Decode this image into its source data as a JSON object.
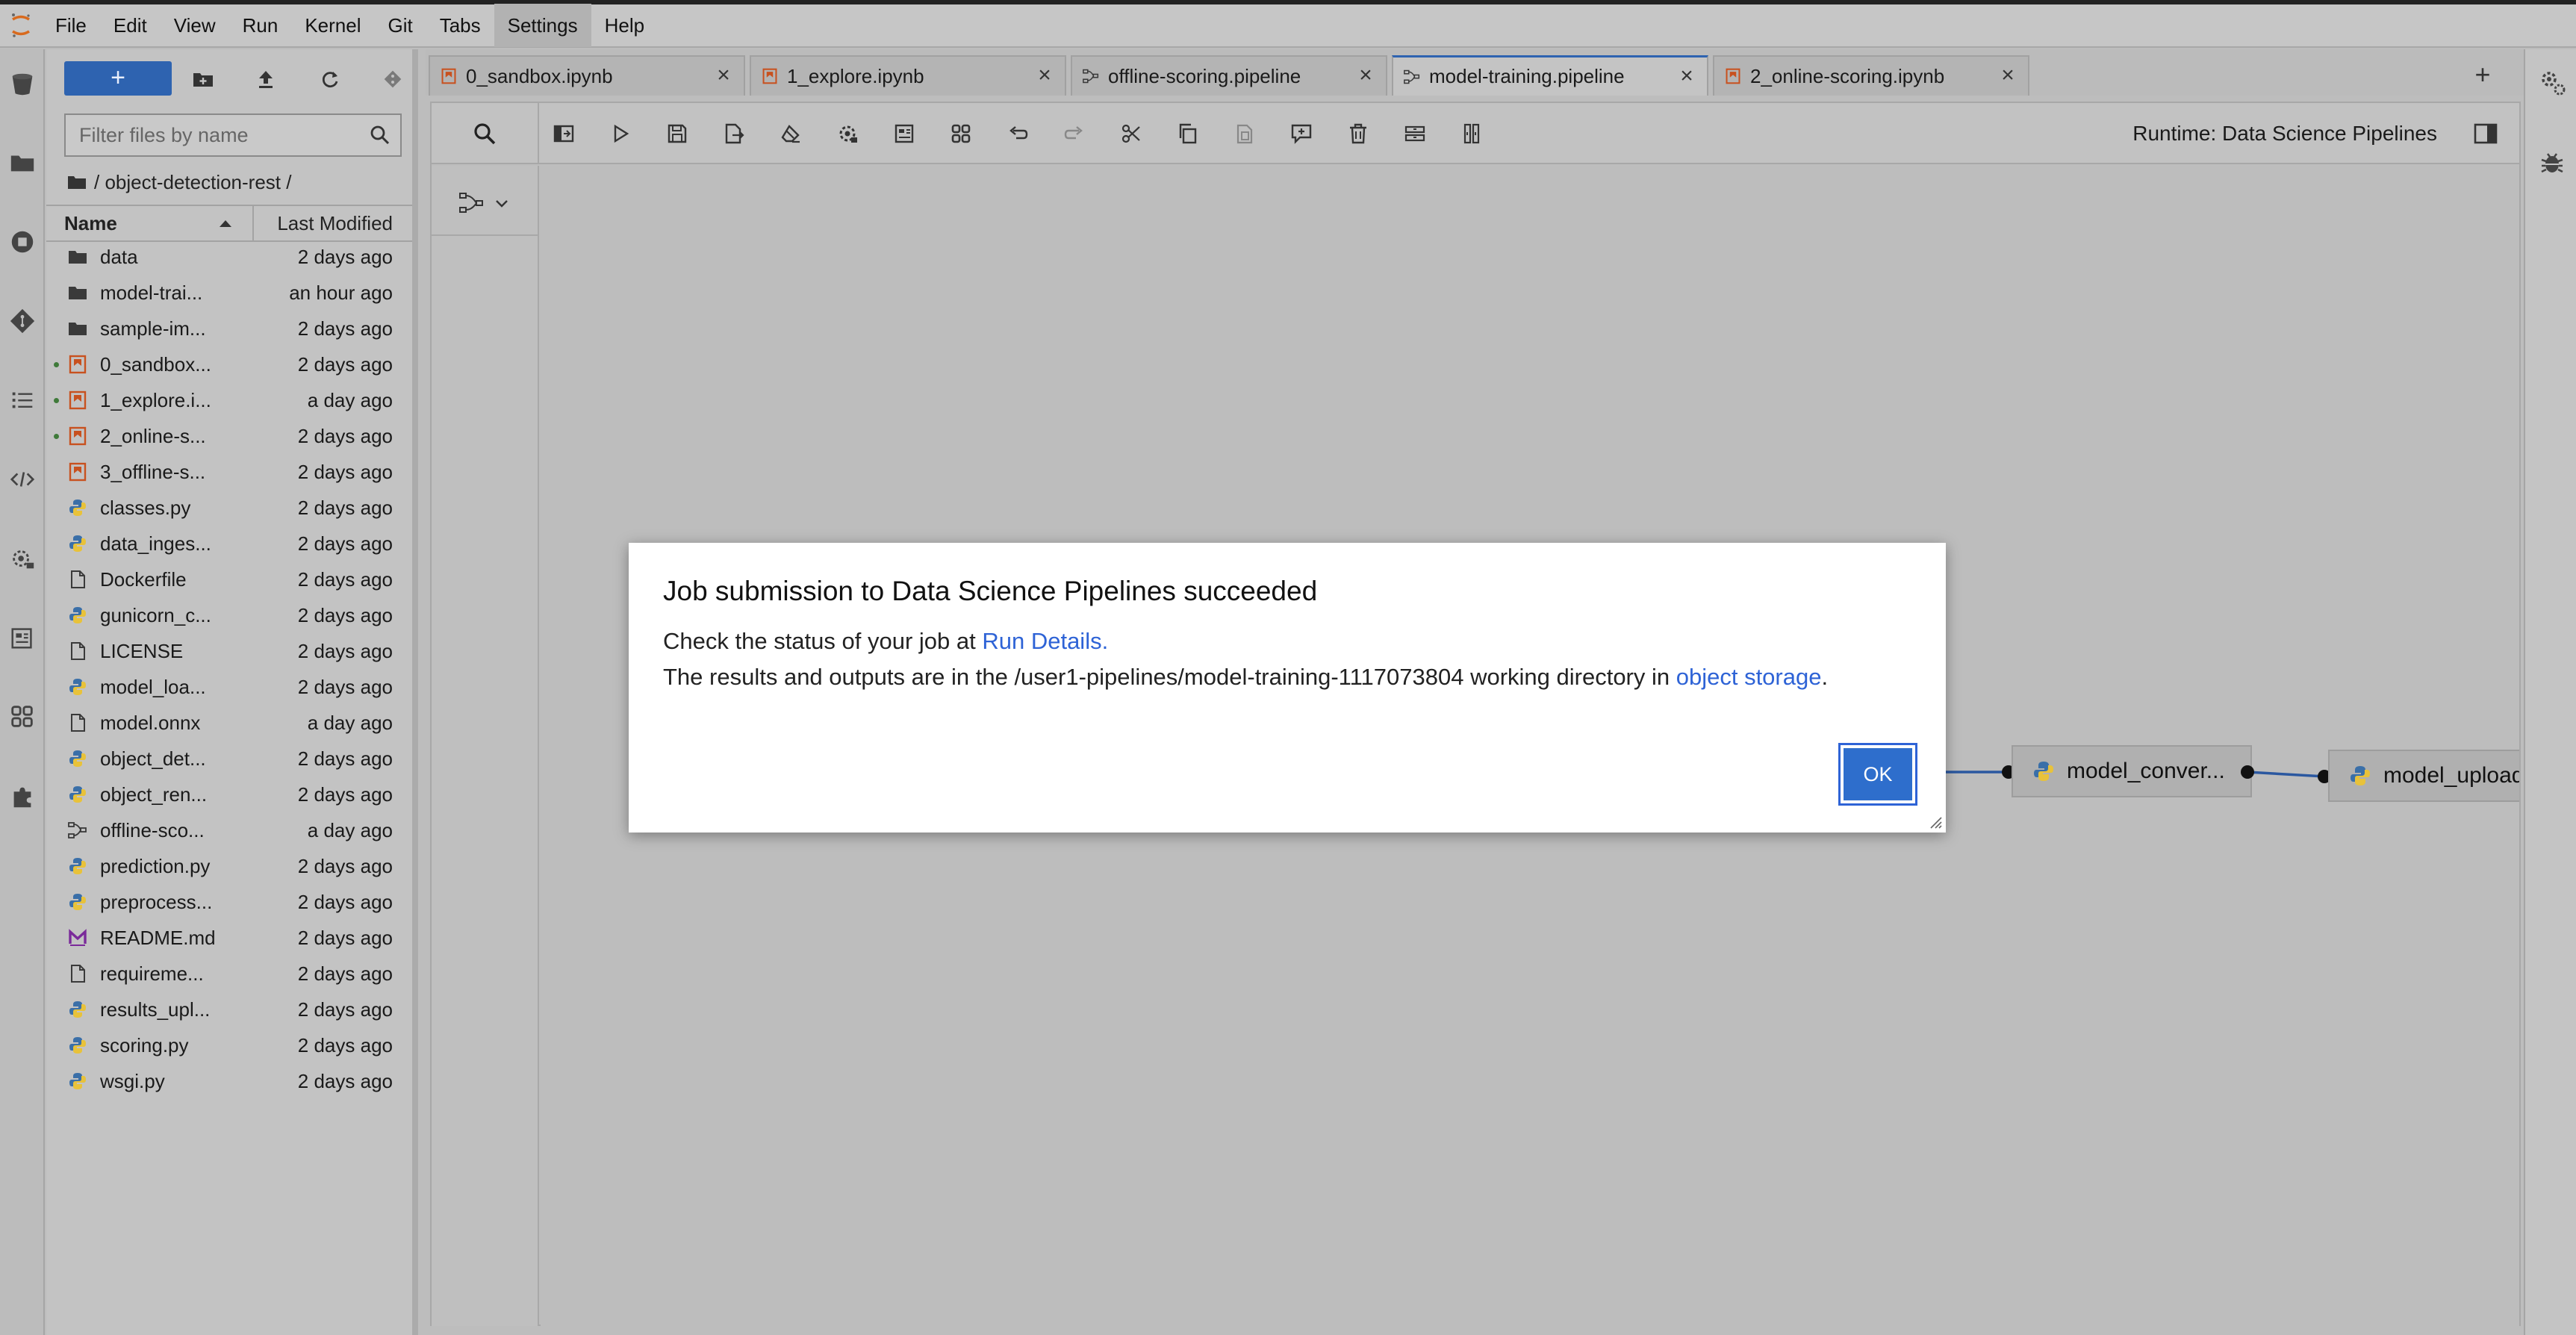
{
  "menubar": {
    "items": [
      "File",
      "Edit",
      "View",
      "Run",
      "Kernel",
      "Git",
      "Tabs",
      "Settings",
      "Help"
    ],
    "active_index": 7
  },
  "file_browser": {
    "new_button_label": "+",
    "filter_placeholder": "Filter files by name",
    "breadcrumb": "/ object-detection-rest /",
    "columns": {
      "name": "Name",
      "modified": "Last Modified"
    },
    "files": [
      {
        "name": "data",
        "modified": "2 days ago",
        "icon": "folder-icon",
        "running": false
      },
      {
        "name": "model-trai...",
        "modified": "an hour ago",
        "icon": "folder-icon",
        "running": false
      },
      {
        "name": "sample-im...",
        "modified": "2 days ago",
        "icon": "folder-icon",
        "running": false
      },
      {
        "name": "0_sandbox...",
        "modified": "2 days ago",
        "icon": "notebook-icon",
        "running": true
      },
      {
        "name": "1_explore.i...",
        "modified": "a day ago",
        "icon": "notebook-icon",
        "running": true
      },
      {
        "name": "2_online-s...",
        "modified": "2 days ago",
        "icon": "notebook-icon",
        "running": true
      },
      {
        "name": "3_offline-s...",
        "modified": "2 days ago",
        "icon": "notebook-icon",
        "running": false
      },
      {
        "name": "classes.py",
        "modified": "2 days ago",
        "icon": "python-icon",
        "running": false
      },
      {
        "name": "data_inges...",
        "modified": "2 days ago",
        "icon": "python-icon",
        "running": false
      },
      {
        "name": "Dockerfile",
        "modified": "2 days ago",
        "icon": "file-icon",
        "running": false
      },
      {
        "name": "gunicorn_c...",
        "modified": "2 days ago",
        "icon": "python-icon",
        "running": false
      },
      {
        "name": "LICENSE",
        "modified": "2 days ago",
        "icon": "file-icon",
        "running": false
      },
      {
        "name": "model_loa...",
        "modified": "2 days ago",
        "icon": "python-icon",
        "running": false
      },
      {
        "name": "model.onnx",
        "modified": "a day ago",
        "icon": "file-icon",
        "running": false
      },
      {
        "name": "object_det...",
        "modified": "2 days ago",
        "icon": "python-icon",
        "running": false
      },
      {
        "name": "object_ren...",
        "modified": "2 days ago",
        "icon": "python-icon",
        "running": false
      },
      {
        "name": "offline-sco...",
        "modified": "a day ago",
        "icon": "pipeline-icon",
        "running": false
      },
      {
        "name": "prediction.py",
        "modified": "2 days ago",
        "icon": "python-icon",
        "running": false
      },
      {
        "name": "preprocess...",
        "modified": "2 days ago",
        "icon": "python-icon",
        "running": false
      },
      {
        "name": "README.md",
        "modified": "2 days ago",
        "icon": "markdown-icon",
        "running": false
      },
      {
        "name": "requireme...",
        "modified": "2 days ago",
        "icon": "file-icon",
        "running": false
      },
      {
        "name": "results_upl...",
        "modified": "2 days ago",
        "icon": "python-icon",
        "running": false
      },
      {
        "name": "scoring.py",
        "modified": "2 days ago",
        "icon": "python-icon",
        "running": false
      },
      {
        "name": "wsgi.py",
        "modified": "2 days ago",
        "icon": "python-icon",
        "running": false
      }
    ]
  },
  "tabs": [
    {
      "label": "0_sandbox.ipynb",
      "icon": "notebook-icon",
      "active": false
    },
    {
      "label": "1_explore.ipynb",
      "icon": "notebook-icon",
      "active": false
    },
    {
      "label": "offline-scoring.pipeline",
      "icon": "pipeline-icon",
      "active": false
    },
    {
      "label": "model-training.pipeline",
      "icon": "pipeline-icon",
      "active": true
    },
    {
      "label": "2_online-scoring.ipynb",
      "icon": "notebook-icon",
      "active": false
    }
  ],
  "editor": {
    "runtime_label": "Runtime: Data Science Pipelines",
    "nodes": [
      "model_conver...",
      "model_upload"
    ]
  },
  "dialog": {
    "title": "Job submission to Data Science Pipelines succeeded",
    "line1_prefix": "Check the status of your job at ",
    "line1_link": "Run Details.",
    "line2_prefix": "The results and outputs are in the /user1-pipelines/model-training-1117073804 working directory in ",
    "line2_link": "object storage",
    "line2_suffix": ".",
    "ok_label": "OK"
  },
  "colors": {
    "accent": "#2e63b0",
    "link": "#2e63d6",
    "notebook": "#c8511f",
    "python_blue": "#3a6fa8",
    "python_yellow": "#e8c23a",
    "markdown": "#7a2a9a",
    "running_dot": "#3f7a3a"
  }
}
